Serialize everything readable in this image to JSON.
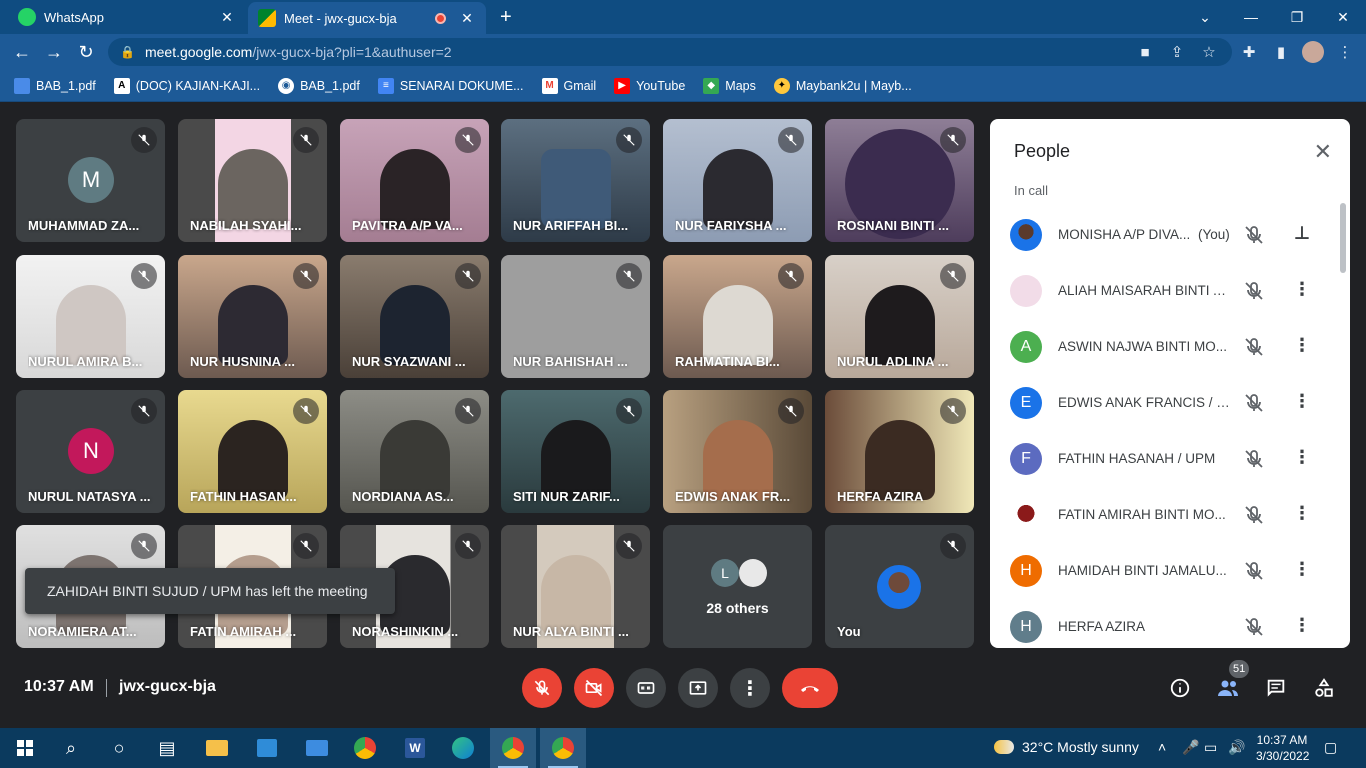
{
  "browser": {
    "tabs": [
      {
        "title": "WhatsApp"
      },
      {
        "title": "Meet - jwx-gucx-bja"
      }
    ],
    "url_host": "meet.google.com",
    "url_path": "/jwx-gucx-bja?pli=1&authuser=2",
    "bookmarks": [
      {
        "label": "BAB_1.pdf"
      },
      {
        "label": "(DOC) KAJIAN-KAJI..."
      },
      {
        "label": "BAB_1.pdf"
      },
      {
        "label": "SENARAI DOKUME..."
      },
      {
        "label": "Gmail"
      },
      {
        "label": "YouTube"
      },
      {
        "label": "Maps"
      },
      {
        "label": "Maybank2u | Mayb..."
      }
    ]
  },
  "meet": {
    "tiles": [
      {
        "name": "MUHAMMAD ZA...",
        "initial": "M",
        "avatar_color": "#5f7b82"
      },
      {
        "name": "NABILAH SYAHI..."
      },
      {
        "name": "PAVITRA A/P VA..."
      },
      {
        "name": "NUR ARIFFAH BI..."
      },
      {
        "name": "NUR FARIYSHA ..."
      },
      {
        "name": "ROSNANI BINTI ..."
      },
      {
        "name": "NURUL AMIRA B..."
      },
      {
        "name": "NUR HUSNINA ..."
      },
      {
        "name": "NUR SYAZWANI ..."
      },
      {
        "name": "NUR BAHISHAH ..."
      },
      {
        "name": "RAHMATINA BI..."
      },
      {
        "name": "NURUL ADLINA ..."
      },
      {
        "name": "NURUL NATASYA ...",
        "initial": "N",
        "avatar_color": "#c2185b"
      },
      {
        "name": "FATHIN HASAN..."
      },
      {
        "name": "NORDIANA AS..."
      },
      {
        "name": "SITI NUR ZARIF..."
      },
      {
        "name": "EDWIS ANAK FR..."
      },
      {
        "name": "HERFA AZIRA"
      },
      {
        "name": "NORAMIERA AT..."
      },
      {
        "name": "FATIN AMIRAH ..."
      },
      {
        "name": "NORASHINKIN ..."
      },
      {
        "name": "NUR ALYA BINTI ..."
      },
      {
        "name": "28 others",
        "others_initial": "L"
      },
      {
        "name": "You"
      }
    ],
    "toast": "ZAHIDAH BINTI SUJUD / UPM has left the meeting",
    "people_panel": {
      "title": "People",
      "section": "In call",
      "participants": [
        {
          "name": "MONISHA A/P DIVA...",
          "suffix": "(You)",
          "initial": "",
          "color": "#1a73e8"
        },
        {
          "name": "ALIAH MAISARAH BINTI A...",
          "initial": "",
          "color": "#f2dce8"
        },
        {
          "name": "ASWIN NAJWA BINTI MO...",
          "initial": "A",
          "color": "#4caf50"
        },
        {
          "name": "EDWIS ANAK FRANCIS / U...",
          "initial": "E",
          "color": "#1a73e8"
        },
        {
          "name": "FATHIN HASANAH / UPM",
          "initial": "F",
          "color": "#5c6bc0"
        },
        {
          "name": "FATIN AMIRAH BINTI MO...",
          "initial": "",
          "color": "#ffffff"
        },
        {
          "name": "HAMIDAH BINTI JAMALU...",
          "initial": "H",
          "color": "#ef6c00"
        },
        {
          "name": "HERFA AZIRA",
          "initial": "H",
          "color": "#607d8b"
        }
      ]
    },
    "time": "10:37 AM",
    "meeting_code": "jwx-gucx-bja",
    "participant_count": "51"
  },
  "taskbar": {
    "weather": "32°C  Mostly sunny",
    "time": "10:37 AM",
    "date": "3/30/2022"
  }
}
